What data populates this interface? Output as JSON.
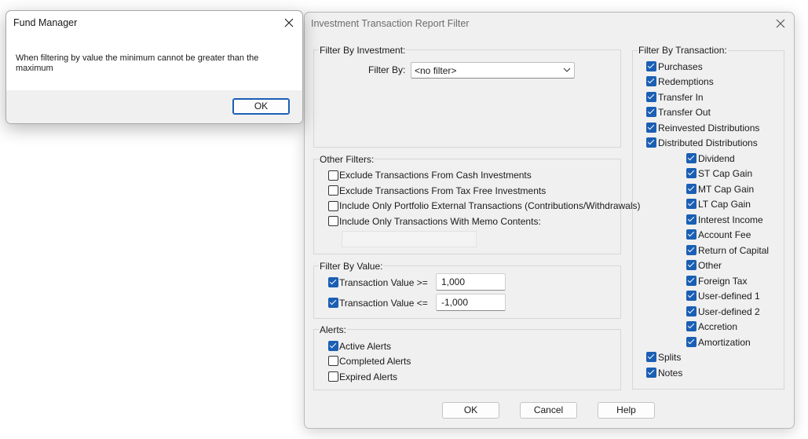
{
  "message_box": {
    "title": "Fund Manager",
    "text": "When filtering by value the minimum cannot be greater than the maximum",
    "ok_label": "OK"
  },
  "dialog": {
    "title": "Investment Transaction Report Filter",
    "filter_by_investment": {
      "label": "Filter By Investment:",
      "filter_by_label": "Filter By:",
      "filter_by_value": "<no filter>"
    },
    "other_filters": {
      "label": "Other Filters:",
      "items": [
        {
          "label": "Exclude Transactions From Cash Investments",
          "checked": false
        },
        {
          "label": "Exclude Transactions From Tax Free Investments",
          "checked": false
        },
        {
          "label": "Include Only Portfolio External Transactions (Contributions/Withdrawals)",
          "checked": false
        },
        {
          "label": "Include Only Transactions With Memo Contents:",
          "checked": false
        }
      ],
      "memo_value": ""
    },
    "filter_by_value": {
      "label": "Filter By Value:",
      "min_label": "Transaction Value >=",
      "min_checked": true,
      "min_value": "1,000",
      "max_label": "Transaction Value <=",
      "max_checked": true,
      "max_value": "-1,000"
    },
    "alerts": {
      "label": "Alerts:",
      "items": [
        {
          "label": "Active Alerts",
          "checked": true
        },
        {
          "label": "Completed Alerts",
          "checked": false
        },
        {
          "label": "Expired Alerts",
          "checked": false
        }
      ]
    },
    "filter_by_transaction": {
      "label": "Filter By Transaction:",
      "items": [
        {
          "label": "Purchases",
          "checked": true
        },
        {
          "label": "Redemptions",
          "checked": true
        },
        {
          "label": "Transfer In",
          "checked": true
        },
        {
          "label": "Transfer Out",
          "checked": true
        },
        {
          "label": "Reinvested Distributions",
          "checked": true
        },
        {
          "label": "Distributed Distributions",
          "checked": true
        }
      ],
      "sub_items": [
        {
          "label": "Dividend",
          "checked": true
        },
        {
          "label": "ST Cap Gain",
          "checked": true
        },
        {
          "label": "MT Cap Gain",
          "checked": true
        },
        {
          "label": "LT Cap Gain",
          "checked": true
        },
        {
          "label": "Interest Income",
          "checked": true
        },
        {
          "label": "Account Fee",
          "checked": true
        },
        {
          "label": "Return of Capital",
          "checked": true
        },
        {
          "label": "Other",
          "checked": true
        },
        {
          "label": "Foreign Tax",
          "checked": true
        },
        {
          "label": "User-defined 1",
          "checked": true
        },
        {
          "label": "User-defined 2",
          "checked": true
        },
        {
          "label": "Accretion",
          "checked": true
        },
        {
          "label": "Amortization",
          "checked": true
        }
      ],
      "tail_items": [
        {
          "label": "Splits",
          "checked": true
        },
        {
          "label": "Notes",
          "checked": true
        }
      ]
    },
    "buttons": {
      "ok": "OK",
      "cancel": "Cancel",
      "help": "Help"
    }
  }
}
